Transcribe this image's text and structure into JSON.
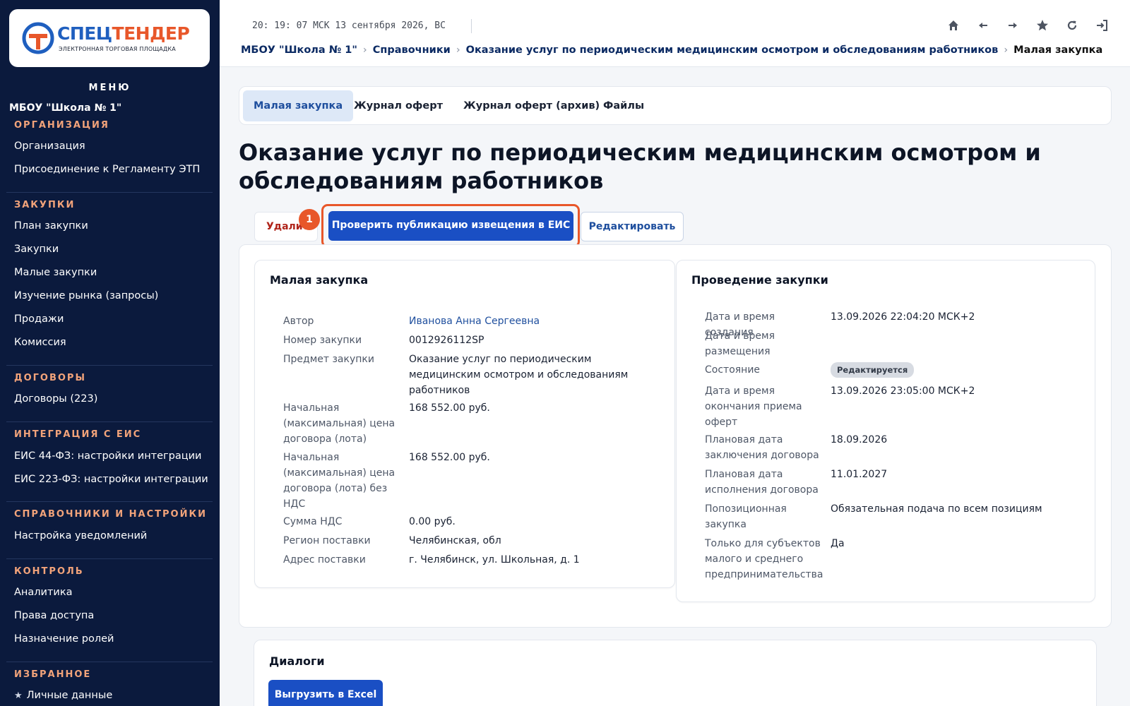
{
  "logo": {
    "part1": "СПЕЦ",
    "part2": "ТЕНДЕР",
    "subtitle": "ЭЛЕКТРОННАЯ ТОРГОВАЯ ПЛОЩАДКА"
  },
  "sidebar": {
    "menu_title": "МЕНЮ",
    "org_name": "МБОУ \"Школа № 1\"",
    "sections": [
      {
        "title": "ОРГАНИЗАЦИЯ",
        "items": [
          "Организация",
          "Присоединение к Регламенту ЭТП"
        ]
      },
      {
        "title": "ЗАКУПКИ",
        "items": [
          "План закупки",
          "Закупки",
          "Малые закупки",
          "Изучение рынка (запросы)",
          "Продажи",
          "Комиссия"
        ]
      },
      {
        "title": "ДОГОВОРЫ",
        "items": [
          "Договоры (223)"
        ]
      },
      {
        "title": "ИНТЕГРАЦИЯ С ЕИС",
        "items": [
          "ЕИС 44-ФЗ: настройки интеграции",
          "ЕИС 223-ФЗ: настройки интеграции"
        ]
      },
      {
        "title": "СПРАВОЧНИКИ И НАСТРОЙКИ",
        "items": [
          "Настройка уведомлений"
        ]
      },
      {
        "title": "КОНТРОЛЬ",
        "items": [
          "Аналитика",
          "Права доступа",
          "Назначение ролей"
        ]
      },
      {
        "title": "ИЗБРАННОЕ",
        "items": [
          "Личные данные"
        ]
      }
    ]
  },
  "topbar": {
    "clock": "20: 19: 07 МСК  13 сентября 2026, ВС",
    "icons": [
      "home-icon",
      "arrow-left-icon",
      "arrow-right-icon",
      "star-icon",
      "refresh-icon",
      "logout-icon"
    ]
  },
  "breadcrumb": [
    "МБОУ \"Школа № 1\"",
    "Справочники",
    "Оказание услуг по периодическим медицинским осмотром и обследованиям работников",
    "Малая закупка"
  ],
  "tabs": [
    "Малая закупка",
    "Журнал оферт",
    "Журнал оферт (архив)",
    "Файлы"
  ],
  "page_title": "Оказание услуг по периодическим медицинским осмотром и обследованиям работников",
  "actions": {
    "delete": "Удалить",
    "check_publication": "Проверить публикацию извещения в ЕИС",
    "edit": "Редактировать",
    "step_badge": "1"
  },
  "left_panel": {
    "title": "Малая закупка",
    "rows": [
      {
        "label": "Автор",
        "value": "Иванова Анна Сергеевна"
      },
      {
        "label": "Номер закупки",
        "value": "0012926112SP"
      },
      {
        "label": "Предмет закупки",
        "value": "Оказание услуг по периодическим медицинским осмотром и обследованиям работников"
      },
      {
        "label": "Начальная (максимальная) цена договора (лота)",
        "value": "168 552.00 руб."
      },
      {
        "label": "Начальная (максимальная) цена договора (лота) без НДС",
        "value": "168 552.00 руб."
      },
      {
        "label": "Сумма НДС",
        "value": "0.00 руб."
      },
      {
        "label": "Регион поставки",
        "value": "Челябинская, обл"
      },
      {
        "label": "Адрес поставки",
        "value": "г. Челябинск, ул. Школьная, д. 1"
      }
    ]
  },
  "right_panel": {
    "title": "Проведение закупки",
    "rows": [
      {
        "label": "Дата и время создания",
        "value": "13.09.2026 22:04:20 МСК+2"
      },
      {
        "label": "Дата и время размещения",
        "value": ""
      },
      {
        "label": "Состояние",
        "value": "Редактируется"
      },
      {
        "label": "Дата и время окончания приема оферт",
        "value": "13.09.2026 23:05:00 МСК+2"
      },
      {
        "label": "Плановая дата заключения договора",
        "value": "18.09.2026"
      },
      {
        "label": "Плановая дата исполнения договора",
        "value": "11.01.2027"
      },
      {
        "label": "Попозиционная закупка",
        "value": "Обязательная подача по всем позициям"
      },
      {
        "label": "Только для субъектов малого и среднего предпринимательства",
        "value": "Да"
      }
    ]
  },
  "dialogs": {
    "title": "Диалоги",
    "export_button": "Выгрузить в Excel"
  },
  "colors": {
    "sidebar_bg": "#0b1a3d",
    "accent": "#1a4fc4",
    "highlight": "#e8572a",
    "section_title": "#f2a37a"
  }
}
